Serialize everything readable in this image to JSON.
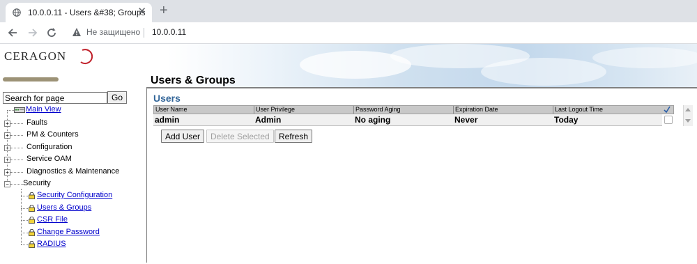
{
  "browser": {
    "tab_title": "10.0.0.11 - Users &#38; Groups",
    "insecure_label": "Не защищено",
    "url": "10.0.0.11"
  },
  "banner": {
    "logo_text": "CERAGON",
    "page_title": "Users & Groups"
  },
  "sidebar": {
    "search_value": "Search for page",
    "go_label": "Go",
    "main_view": "Main View",
    "items": [
      {
        "label": "Faults"
      },
      {
        "label": "PM & Counters"
      },
      {
        "label": "Configuration"
      },
      {
        "label": "Service OAM"
      },
      {
        "label": "Diagnostics & Maintenance"
      },
      {
        "label": "Security"
      }
    ],
    "security_children": [
      {
        "label": "Security Configuration"
      },
      {
        "label": "Users & Groups"
      },
      {
        "label": "CSR File"
      },
      {
        "label": "Change Password"
      },
      {
        "label": "RADIUS"
      }
    ]
  },
  "main": {
    "section_title": "Users",
    "columns": [
      "User Name",
      "User Privilege",
      "Password Aging",
      "Expiration Date",
      "Last Logout Time"
    ],
    "rows": [
      [
        "admin",
        "Admin",
        "No aging",
        "Never",
        "Today"
      ]
    ],
    "buttons": {
      "add_user": "Add User",
      "delete_selected": "Delete Selected",
      "refresh": "Refresh"
    }
  },
  "colors": {
    "section_title": "#336699",
    "link": "#0000cc",
    "lock": "#f2d33a"
  }
}
